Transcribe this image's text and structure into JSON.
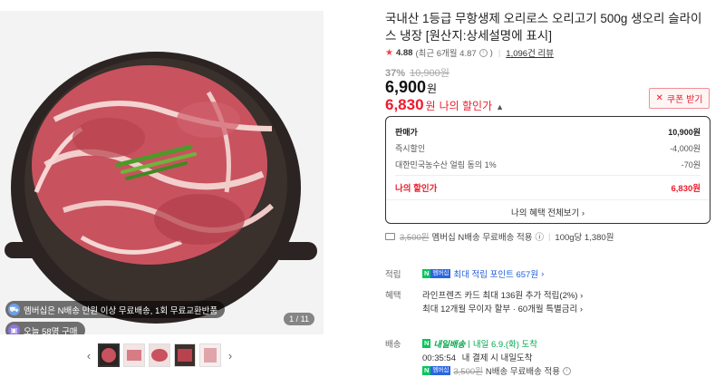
{
  "gallery": {
    "badge_delivery": "멤버십은 N배송 만원 이상 무료배송, 1회 무료교환반품",
    "badge_buyers": "오늘 58명 구매",
    "counter": "1 / 11",
    "prev_arrow": "‹",
    "next_arrow": "›",
    "thumbnail_count": 5,
    "active_thumbnail": 1
  },
  "product": {
    "title": "국내산 1등급 무항생제 오리로스 오리고기 500g 생오리 슬라이스 냉장 [원산지:상세설명에 표시]",
    "rating": {
      "score": "4.88",
      "recent": "(최근 6개월 4.87",
      "recent_close": ")",
      "reviews": "1,096건 리뷰"
    },
    "discount_rate": "37%",
    "original_price": "10,900원",
    "sale_price": "6,900",
    "currency": "원",
    "my_price": "6,830",
    "my_price_label": "나의 할인가",
    "coupon_label": "쿠폰 받기"
  },
  "price_breakdown": {
    "header_label": "판매가",
    "header_value": "10,900원",
    "rows": [
      {
        "label": "즉시할인",
        "value": "-4,000원"
      },
      {
        "label": "대한민국농수산 얼림 동의 1%",
        "value": "-70원"
      }
    ],
    "mine_label": "나의 할인가",
    "mine_value": "6,830원",
    "benefits_link": "나의 혜택 전체보기 ›"
  },
  "shipping": {
    "strike_fee": "3,500원",
    "membership_text": "멤버십 N배송 무료배송 적용",
    "info_icon": "ⓘ",
    "per_unit": "100g당 1,380원"
  },
  "sections": {
    "points_label": "적립",
    "points_text": "최대 적립 포인트 657원",
    "benefit_label": "혜택",
    "benefit1": "라인프렌즈 카드 최대 136원 추가 적립(2%) ›",
    "benefit2": "최대 12개월 무이자 할부 · 60개월 특별금리 ›",
    "delivery_label": "배송",
    "delivery_tomorrow": "내일배송",
    "delivery_date": "내일 6.9.(화) 도착",
    "deadline_time": "00:35:54",
    "deadline_text": "내 결제 시 내일도착",
    "ship2_strike": "3,500원",
    "ship2_text": "N배송 무료배송 적용"
  },
  "badges": {
    "npay_n": "N",
    "npay_m": "멤버십"
  },
  "colors": {
    "sale_red": "#ec1c2d",
    "link_blue": "#1f5fd6",
    "naver_green": "#03c75a"
  }
}
